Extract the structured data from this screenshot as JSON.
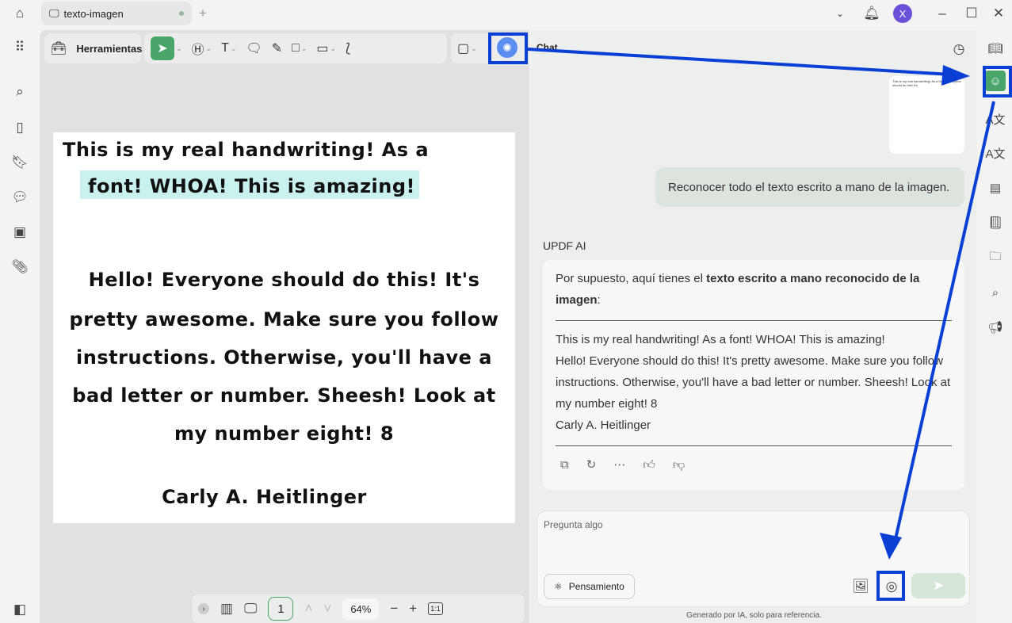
{
  "titlebar": {
    "tab_title": "texto-imagen",
    "new_tab": "+",
    "avatar": "X"
  },
  "toolbar": {
    "tools_label": "Herramientas"
  },
  "document": {
    "lines": [
      "This is my real handwriting! As a",
      "font! WHOA! This is amazing!",
      "Hello! Everyone should do this! It's",
      "pretty awesome. Make sure you follow",
      "instructions. Otherwise, you'll have a",
      "bad letter or number. Sheesh! Look at",
      "my number eight! 8",
      "Carly A. Heitlinger"
    ]
  },
  "bottombar": {
    "page": "1",
    "zoom": "64%",
    "fit": "1:1"
  },
  "chat": {
    "title": "Chat",
    "user_message": "Reconocer todo el texto escrito a mano de la imagen.",
    "ai_name": "UPDF AI",
    "ai_intro": "Por supuesto, aquí tienes el ",
    "ai_intro_bold": "texto escrito a mano reconocido de la imagen",
    "ai_intro_end": ":",
    "ai_lines": [
      "This is my real handwriting! As a font! WHOA! This is amazing!",
      "Hello! Everyone should do this! It's pretty awesome. Make sure you follow instructions. Otherwise, you'll have a bad letter or number. Sheesh! Look at my number eight! 8",
      "Carly A. Heitlinger"
    ],
    "input_placeholder": "Pregunta algo",
    "thinking_label": "Pensamiento",
    "footer": "Generado por IA, solo para referencia."
  },
  "colors": {
    "accent_green": "#4aa56a",
    "highlight_blue": "#0a3fd6"
  }
}
